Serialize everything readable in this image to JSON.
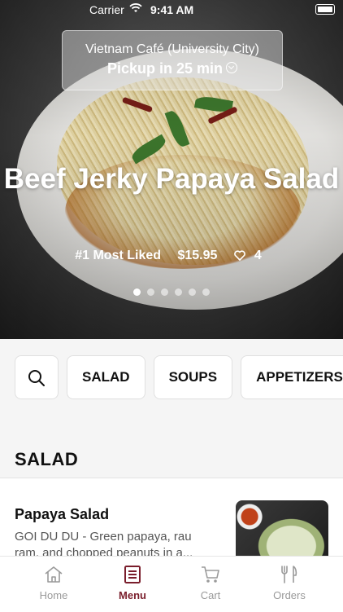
{
  "status_bar": {
    "carrier": "Carrier",
    "time": "9:41 AM",
    "icons": [
      "wifi-icon",
      "battery-icon"
    ]
  },
  "location": {
    "name": "Vietnam Café (University City)",
    "pickup": "Pickup in 25 min",
    "icon": "chevron-down-circle-icon"
  },
  "featured": {
    "title": "Beef Jerky Papaya Salad",
    "rank": "#1 Most Liked",
    "price": "$15.95",
    "likes": "4",
    "carousel": {
      "count": 6,
      "active_index": 0
    }
  },
  "categories": {
    "search_icon": "search-icon",
    "items": [
      "SALAD",
      "SOUPS",
      "APPETIZERS"
    ]
  },
  "section": {
    "title": "SALAD"
  },
  "menu_item": {
    "name": "Papaya Salad",
    "description": "GOI DU DU - Green papaya, rau ram, and chopped peanuts in a..."
  },
  "tabs": [
    {
      "label": "Home",
      "icon": "home-icon",
      "active": false
    },
    {
      "label": "Menu",
      "icon": "menu-book-icon",
      "active": true
    },
    {
      "label": "Cart",
      "icon": "cart-icon",
      "active": false
    },
    {
      "label": "Orders",
      "icon": "fork-knife-icon",
      "active": false
    }
  ],
  "colors": {
    "accent": "#7a1e2c",
    "inactive_tab": "#9a9a9a"
  }
}
